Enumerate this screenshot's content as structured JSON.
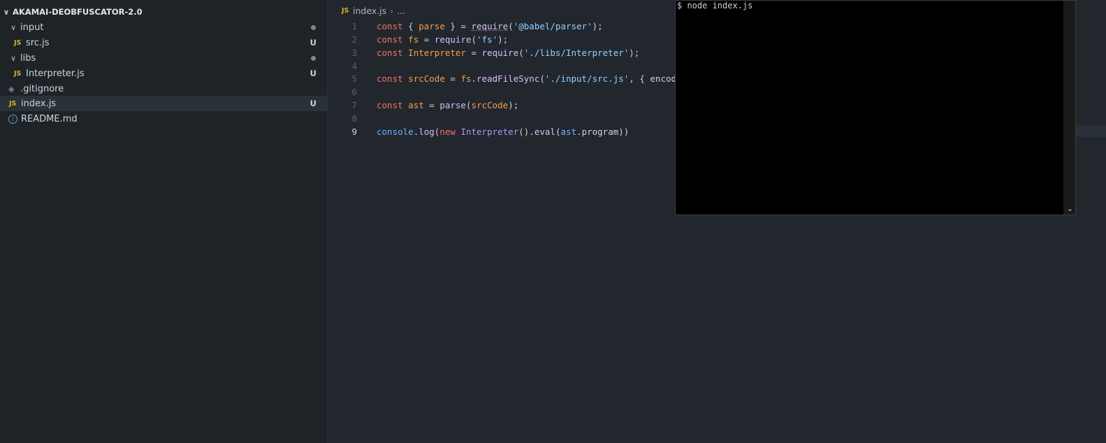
{
  "sidebar": {
    "root_label": "AKAMAI-DEOBFUSCATOR-2.0",
    "items": [
      {
        "label": "input",
        "kind": "folder"
      },
      {
        "label": "src.js",
        "kind": "js",
        "status": "U"
      },
      {
        "label": "libs",
        "kind": "folder"
      },
      {
        "label": "Interpreter.js",
        "kind": "js",
        "status": "U"
      },
      {
        "label": ".gitignore",
        "kind": "git"
      },
      {
        "label": "index.js",
        "kind": "js",
        "status": "U"
      },
      {
        "label": "README.md",
        "kind": "info"
      }
    ],
    "js_badge": "JS",
    "chevron": "∨"
  },
  "editor": {
    "breadcrumb_file": "index.js",
    "breadcrumb_more": "...",
    "line_numbers": [
      "1",
      "2",
      "3",
      "4",
      "5",
      "6",
      "7",
      "8",
      "9"
    ],
    "lines": {
      "l1": [
        "const",
        " { ",
        "parse",
        " } = ",
        "require",
        "(",
        "'@babel/parser'",
        ");"
      ],
      "l2": [
        "const",
        " ",
        "fs",
        " = ",
        "require",
        "(",
        "'fs'",
        ");"
      ],
      "l3": [
        "const",
        " ",
        "Interpreter",
        " = ",
        "require",
        "(",
        "'./libs/Interpreter'",
        ");"
      ],
      "l5": [
        "const",
        " ",
        "srcCode",
        " = ",
        "fs",
        ".",
        "readFileSync",
        "(",
        "'./input/src.js'",
        ", { ",
        "encod"
      ],
      "l7": [
        "const",
        " ",
        "ast",
        " = ",
        "parse",
        "(",
        "srcCode",
        ");"
      ],
      "l9": [
        "console",
        ".",
        "log",
        "(",
        "new",
        " ",
        "Interpreter",
        "()",
        ".",
        "eval",
        "(",
        "ast",
        ".",
        "program",
        "))"
      ]
    }
  },
  "terminal": {
    "text": "$ node index.js",
    "scroll_icon": "⌄"
  }
}
